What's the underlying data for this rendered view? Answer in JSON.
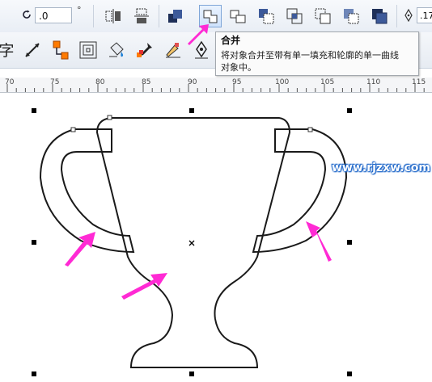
{
  "toolbar": {
    "rotation_value": ".0",
    "rotation_unit": "°",
    "outline_width_value": ".17",
    "text_tool_glyph": "字"
  },
  "tooltip": {
    "title": "合并",
    "description": "将对象合并至带有单一填充和轮廓的单一曲线\n对象中。"
  },
  "ruler": {
    "labels": [
      "70",
      "75",
      "80",
      "85",
      "90",
      "95",
      "100",
      "105",
      "110",
      "115"
    ]
  },
  "watermark": "www.rjzxw.com",
  "colors": {
    "arrow": "#ff2ad4",
    "watermark_outline": "#1a64c8",
    "toolbar_bg": "#e9eef5"
  }
}
